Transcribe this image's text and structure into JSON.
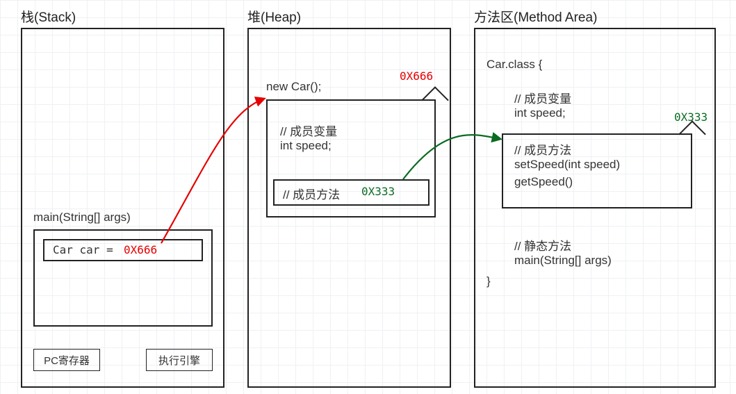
{
  "stack": {
    "label": "栈(Stack)",
    "main_label": "main(String[] args)",
    "car_decl": "Car car =",
    "car_addr": "0X666",
    "pc_register": "PC寄存器",
    "exec_engine": "执行引擎"
  },
  "heap": {
    "label": "堆(Heap)",
    "new_car": "new Car();",
    "addr_tag": "0X666",
    "field_comment": "// 成员变量",
    "field_decl": "int speed;",
    "method_comment": "// 成员方法",
    "method_addr": "0X333"
  },
  "method_area": {
    "label": "方法区(Method Area)",
    "class_header": "Car.class {",
    "field_comment": "// 成员变量",
    "field_decl": "int speed;",
    "addr_tag": "0X333",
    "method_comment": "// 成员方法",
    "method1": "setSpeed(int speed)",
    "method2": "getSpeed()",
    "static_comment": "// 静态方法",
    "static_method": "main(String[] args)",
    "class_close": "}"
  },
  "arrow_colors": {
    "stack_to_heap": "#e60000",
    "heap_to_method": "#0a6b21"
  }
}
